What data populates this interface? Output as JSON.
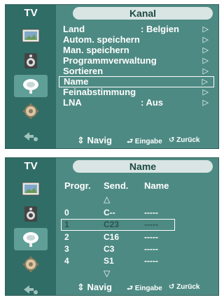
{
  "menu1": {
    "tv_label": "TV",
    "title": "Kanal",
    "items": [
      {
        "label": "Land",
        "value": ": Belgien",
        "arrow": "▷"
      },
      {
        "label": "Autom. speichern",
        "value": "",
        "arrow": "▷"
      },
      {
        "label": "Man. speichern",
        "value": "",
        "arrow": "▷"
      },
      {
        "label": "Programmverwaltung",
        "value": "",
        "arrow": "▷"
      },
      {
        "label": "Sortieren",
        "value": "",
        "arrow": "▷"
      },
      {
        "label": "Name",
        "value": "",
        "arrow": "▷"
      },
      {
        "label": "Feinabstimmung",
        "value": "",
        "arrow": "▷"
      },
      {
        "label": "LNA",
        "value": ": Aus",
        "arrow": "▷"
      }
    ],
    "selected_index": 5
  },
  "menu2": {
    "tv_label": "TV",
    "title": "Name",
    "headers": {
      "prog": "Progr.",
      "send": "Send.",
      "name": "Name"
    },
    "up_arrow": "△",
    "down_arrow": "▽",
    "rows": [
      {
        "prog": "0",
        "send": "C--",
        "name": "-----"
      },
      {
        "prog": "1",
        "send": "C23",
        "name": "-----"
      },
      {
        "prog": "2",
        "send": "C16",
        "name": "-----"
      },
      {
        "prog": "3",
        "send": "C3",
        "name": "-----"
      },
      {
        "prog": "4",
        "send": "S1",
        "name": "-----"
      }
    ],
    "selected_index": 1
  },
  "footer": {
    "nav": "⇕ Navig",
    "enter": "⮐ Eingabe",
    "return": "↺ Zurück"
  },
  "sidebar_icons": [
    "picture-icon",
    "sound-icon",
    "channel-icon",
    "setup-icon",
    "input-icon"
  ],
  "colors": {
    "panel": "#4d8a83",
    "dark": "#2f6d66",
    "pill": "#d9e5e3",
    "selected_text": "#2b5550"
  }
}
